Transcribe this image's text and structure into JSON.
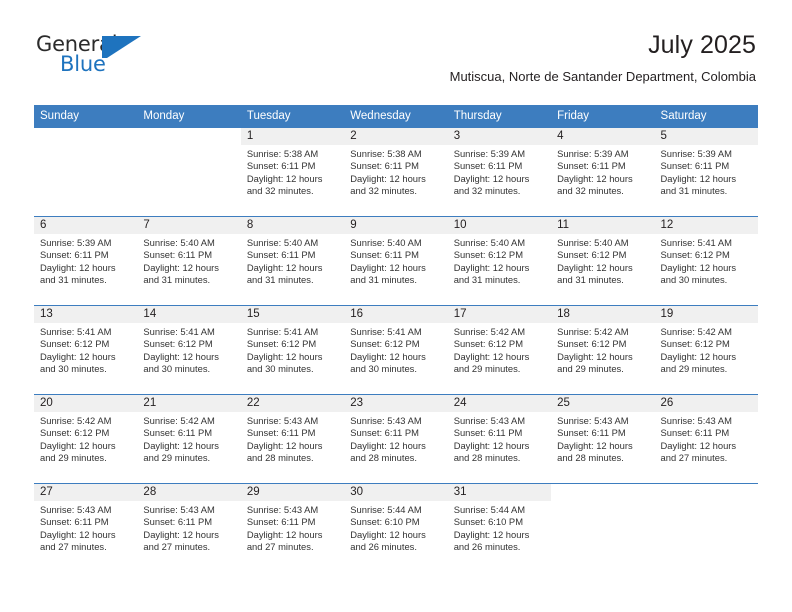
{
  "brand": {
    "line1": "General",
    "line2": "Blue",
    "mark": "triangle-flag-icon",
    "accent_color": "#1e73be"
  },
  "header": {
    "title": "July 2025",
    "subtitle": "Mutiscua, Norte de Santander Department, Colombia"
  },
  "calendar": {
    "header_color": "#3d7dbf",
    "daynum_bg": "#f0f0f0",
    "weekdays": [
      "Sunday",
      "Monday",
      "Tuesday",
      "Wednesday",
      "Thursday",
      "Friday",
      "Saturday"
    ],
    "weeks": [
      [
        {
          "day": "",
          "sunrise": "",
          "sunset": "",
          "daylight_1": "",
          "daylight_2": ""
        },
        {
          "day": "",
          "sunrise": "",
          "sunset": "",
          "daylight_1": "",
          "daylight_2": ""
        },
        {
          "day": "1",
          "sunrise": "Sunrise: 5:38 AM",
          "sunset": "Sunset: 6:11 PM",
          "daylight_1": "Daylight: 12 hours",
          "daylight_2": "and 32 minutes."
        },
        {
          "day": "2",
          "sunrise": "Sunrise: 5:38 AM",
          "sunset": "Sunset: 6:11 PM",
          "daylight_1": "Daylight: 12 hours",
          "daylight_2": "and 32 minutes."
        },
        {
          "day": "3",
          "sunrise": "Sunrise: 5:39 AM",
          "sunset": "Sunset: 6:11 PM",
          "daylight_1": "Daylight: 12 hours",
          "daylight_2": "and 32 minutes."
        },
        {
          "day": "4",
          "sunrise": "Sunrise: 5:39 AM",
          "sunset": "Sunset: 6:11 PM",
          "daylight_1": "Daylight: 12 hours",
          "daylight_2": "and 32 minutes."
        },
        {
          "day": "5",
          "sunrise": "Sunrise: 5:39 AM",
          "sunset": "Sunset: 6:11 PM",
          "daylight_1": "Daylight: 12 hours",
          "daylight_2": "and 31 minutes."
        }
      ],
      [
        {
          "day": "6",
          "sunrise": "Sunrise: 5:39 AM",
          "sunset": "Sunset: 6:11 PM",
          "daylight_1": "Daylight: 12 hours",
          "daylight_2": "and 31 minutes."
        },
        {
          "day": "7",
          "sunrise": "Sunrise: 5:40 AM",
          "sunset": "Sunset: 6:11 PM",
          "daylight_1": "Daylight: 12 hours",
          "daylight_2": "and 31 minutes."
        },
        {
          "day": "8",
          "sunrise": "Sunrise: 5:40 AM",
          "sunset": "Sunset: 6:11 PM",
          "daylight_1": "Daylight: 12 hours",
          "daylight_2": "and 31 minutes."
        },
        {
          "day": "9",
          "sunrise": "Sunrise: 5:40 AM",
          "sunset": "Sunset: 6:11 PM",
          "daylight_1": "Daylight: 12 hours",
          "daylight_2": "and 31 minutes."
        },
        {
          "day": "10",
          "sunrise": "Sunrise: 5:40 AM",
          "sunset": "Sunset: 6:12 PM",
          "daylight_1": "Daylight: 12 hours",
          "daylight_2": "and 31 minutes."
        },
        {
          "day": "11",
          "sunrise": "Sunrise: 5:40 AM",
          "sunset": "Sunset: 6:12 PM",
          "daylight_1": "Daylight: 12 hours",
          "daylight_2": "and 31 minutes."
        },
        {
          "day": "12",
          "sunrise": "Sunrise: 5:41 AM",
          "sunset": "Sunset: 6:12 PM",
          "daylight_1": "Daylight: 12 hours",
          "daylight_2": "and 30 minutes."
        }
      ],
      [
        {
          "day": "13",
          "sunrise": "Sunrise: 5:41 AM",
          "sunset": "Sunset: 6:12 PM",
          "daylight_1": "Daylight: 12 hours",
          "daylight_2": "and 30 minutes."
        },
        {
          "day": "14",
          "sunrise": "Sunrise: 5:41 AM",
          "sunset": "Sunset: 6:12 PM",
          "daylight_1": "Daylight: 12 hours",
          "daylight_2": "and 30 minutes."
        },
        {
          "day": "15",
          "sunrise": "Sunrise: 5:41 AM",
          "sunset": "Sunset: 6:12 PM",
          "daylight_1": "Daylight: 12 hours",
          "daylight_2": "and 30 minutes."
        },
        {
          "day": "16",
          "sunrise": "Sunrise: 5:41 AM",
          "sunset": "Sunset: 6:12 PM",
          "daylight_1": "Daylight: 12 hours",
          "daylight_2": "and 30 minutes."
        },
        {
          "day": "17",
          "sunrise": "Sunrise: 5:42 AM",
          "sunset": "Sunset: 6:12 PM",
          "daylight_1": "Daylight: 12 hours",
          "daylight_2": "and 29 minutes."
        },
        {
          "day": "18",
          "sunrise": "Sunrise: 5:42 AM",
          "sunset": "Sunset: 6:12 PM",
          "daylight_1": "Daylight: 12 hours",
          "daylight_2": "and 29 minutes."
        },
        {
          "day": "19",
          "sunrise": "Sunrise: 5:42 AM",
          "sunset": "Sunset: 6:12 PM",
          "daylight_1": "Daylight: 12 hours",
          "daylight_2": "and 29 minutes."
        }
      ],
      [
        {
          "day": "20",
          "sunrise": "Sunrise: 5:42 AM",
          "sunset": "Sunset: 6:12 PM",
          "daylight_1": "Daylight: 12 hours",
          "daylight_2": "and 29 minutes."
        },
        {
          "day": "21",
          "sunrise": "Sunrise: 5:42 AM",
          "sunset": "Sunset: 6:11 PM",
          "daylight_1": "Daylight: 12 hours",
          "daylight_2": "and 29 minutes."
        },
        {
          "day": "22",
          "sunrise": "Sunrise: 5:43 AM",
          "sunset": "Sunset: 6:11 PM",
          "daylight_1": "Daylight: 12 hours",
          "daylight_2": "and 28 minutes."
        },
        {
          "day": "23",
          "sunrise": "Sunrise: 5:43 AM",
          "sunset": "Sunset: 6:11 PM",
          "daylight_1": "Daylight: 12 hours",
          "daylight_2": "and 28 minutes."
        },
        {
          "day": "24",
          "sunrise": "Sunrise: 5:43 AM",
          "sunset": "Sunset: 6:11 PM",
          "daylight_1": "Daylight: 12 hours",
          "daylight_2": "and 28 minutes."
        },
        {
          "day": "25",
          "sunrise": "Sunrise: 5:43 AM",
          "sunset": "Sunset: 6:11 PM",
          "daylight_1": "Daylight: 12 hours",
          "daylight_2": "and 28 minutes."
        },
        {
          "day": "26",
          "sunrise": "Sunrise: 5:43 AM",
          "sunset": "Sunset: 6:11 PM",
          "daylight_1": "Daylight: 12 hours",
          "daylight_2": "and 27 minutes."
        }
      ],
      [
        {
          "day": "27",
          "sunrise": "Sunrise: 5:43 AM",
          "sunset": "Sunset: 6:11 PM",
          "daylight_1": "Daylight: 12 hours",
          "daylight_2": "and 27 minutes."
        },
        {
          "day": "28",
          "sunrise": "Sunrise: 5:43 AM",
          "sunset": "Sunset: 6:11 PM",
          "daylight_1": "Daylight: 12 hours",
          "daylight_2": "and 27 minutes."
        },
        {
          "day": "29",
          "sunrise": "Sunrise: 5:43 AM",
          "sunset": "Sunset: 6:11 PM",
          "daylight_1": "Daylight: 12 hours",
          "daylight_2": "and 27 minutes."
        },
        {
          "day": "30",
          "sunrise": "Sunrise: 5:44 AM",
          "sunset": "Sunset: 6:10 PM",
          "daylight_1": "Daylight: 12 hours",
          "daylight_2": "and 26 minutes."
        },
        {
          "day": "31",
          "sunrise": "Sunrise: 5:44 AM",
          "sunset": "Sunset: 6:10 PM",
          "daylight_1": "Daylight: 12 hours",
          "daylight_2": "and 26 minutes."
        },
        {
          "day": "",
          "sunrise": "",
          "sunset": "",
          "daylight_1": "",
          "daylight_2": ""
        },
        {
          "day": "",
          "sunrise": "",
          "sunset": "",
          "daylight_1": "",
          "daylight_2": ""
        }
      ]
    ]
  }
}
